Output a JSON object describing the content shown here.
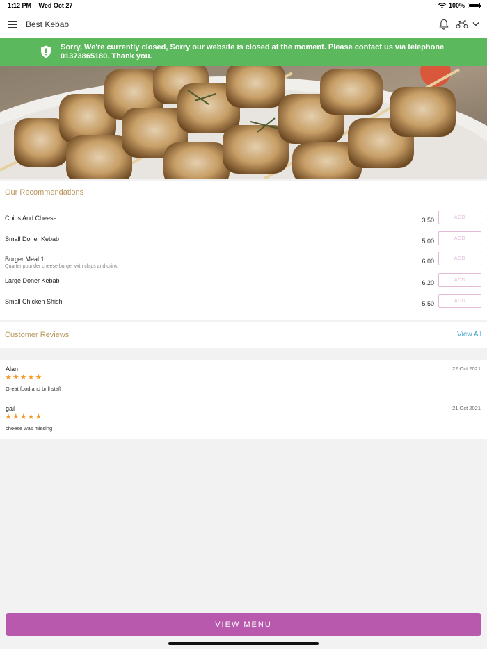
{
  "status": {
    "time": "1:12 PM",
    "date": "Wed Oct 27",
    "battery": "100%"
  },
  "header": {
    "shop_name": "Best Kebab"
  },
  "alert": {
    "message": "Sorry, We're currently closed, Sorry our website is closed at the moment. Please contact us via telephone 01373865180. Thank you."
  },
  "recommendations": {
    "title": "Our Recommendations",
    "add_label": "ADD",
    "items": [
      {
        "name": "Chips And Cheese",
        "desc": "",
        "price": "3.50"
      },
      {
        "name": "Small Doner Kebab",
        "desc": "",
        "price": "5.00"
      },
      {
        "name": "Burger Meal 1",
        "desc": "Quarter pounder cheese burger with chips and drink",
        "price": "6.00"
      },
      {
        "name": "Large Doner Kebab",
        "desc": "",
        "price": "6.20"
      },
      {
        "name": "Small Chicken Shish",
        "desc": "",
        "price": "5.50"
      }
    ]
  },
  "reviews": {
    "title": "Customer Reviews",
    "view_all": "View All",
    "items": [
      {
        "author": "Alan",
        "date": "22 Oct 2021",
        "stars": 5,
        "text": "Great food and brill staff"
      },
      {
        "author": "gail",
        "date": "21 Oct 2021",
        "stars": 5,
        "text": "cheese was missing"
      }
    ]
  },
  "footer": {
    "view_menu": "VIEW MENU"
  },
  "colors": {
    "accent": "#b959ae",
    "alert_bg": "#5cb85c",
    "section_title": "#b8975c",
    "link": "#3aa0c8",
    "star": "#f29a23"
  },
  "icons": [
    "menu-icon",
    "bell-icon",
    "scooter-icon",
    "chevron-down-icon",
    "shield-icon",
    "wifi-icon",
    "battery-icon",
    "star-icon"
  ]
}
